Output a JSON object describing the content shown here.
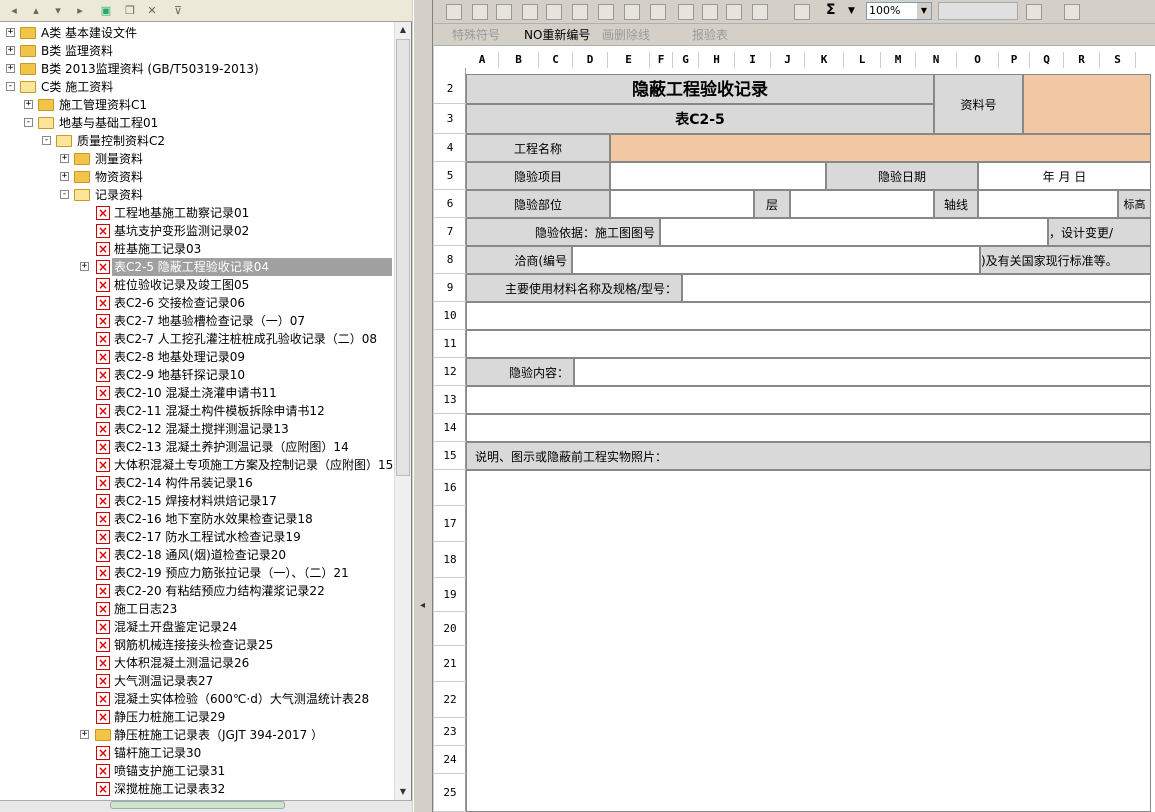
{
  "left_toolbar": {
    "icons": [
      "arrow-left-icon",
      "arrow-up-icon",
      "arrow-down-icon",
      "arrow-right-icon",
      "new-doc-icon",
      "copy-icon",
      "delete-icon",
      "filter-icon"
    ]
  },
  "tree": [
    {
      "label": "A类 基本建设文件",
      "type": "folder",
      "expander": "+"
    },
    {
      "label": "B类 监理资料",
      "type": "folder",
      "expander": "+"
    },
    {
      "label": "B类 2013监理资料 (GB/T50319-2013)",
      "type": "folder",
      "expander": "+"
    },
    {
      "label": "C类 施工资料",
      "type": "folder-open",
      "expander": "-"
    },
    {
      "label": "施工管理资料C1",
      "type": "folder",
      "expander": "+"
    },
    {
      "label": "地基与基础工程01",
      "type": "folder-open",
      "expander": "-"
    },
    {
      "label": "质量控制资料C2",
      "type": "folder-open",
      "expander": "-"
    },
    {
      "label": "测量资料",
      "type": "folder",
      "expander": "+"
    },
    {
      "label": "物资资料",
      "type": "folder",
      "expander": "+"
    },
    {
      "label": "记录资料",
      "type": "folder-open",
      "expander": "-"
    },
    {
      "label": "工程地基施工勘察记录01",
      "type": "doc"
    },
    {
      "label": "基坑支护变形监测记录02",
      "type": "doc"
    },
    {
      "label": "桩基施工记录03",
      "type": "doc"
    },
    {
      "label": "表C2-5 隐蔽工程验收记录04",
      "type": "doc",
      "expander": "+",
      "selected": true
    },
    {
      "label": "桩位验收记录及竣工图05",
      "type": "doc"
    },
    {
      "label": "表C2-6 交接检查记录06",
      "type": "doc"
    },
    {
      "label": "表C2-7 地基验槽检查记录（一）07",
      "type": "doc"
    },
    {
      "label": "表C2-7 人工挖孔灌注桩桩成孔验收记录（二）08",
      "type": "doc"
    },
    {
      "label": "表C2-8 地基处理记录09",
      "type": "doc"
    },
    {
      "label": "表C2-9 地基钎探记录10",
      "type": "doc"
    },
    {
      "label": "表C2-10 混凝土浇灌申请书11",
      "type": "doc"
    },
    {
      "label": "表C2-11 混凝土构件模板拆除申请书12",
      "type": "doc"
    },
    {
      "label": "表C2-12 混凝土搅拌测温记录13",
      "type": "doc"
    },
    {
      "label": "表C2-13 混凝土养护测温记录（应附图）14",
      "type": "doc"
    },
    {
      "label": "大体积混凝土专项施工方案及控制记录（应附图）15",
      "type": "doc"
    },
    {
      "label": "表C2-14 构件吊装记录16",
      "type": "doc"
    },
    {
      "label": "表C2-15 焊接材料烘焙记录17",
      "type": "doc"
    },
    {
      "label": "表C2-16 地下室防水效果检查记录18",
      "type": "doc"
    },
    {
      "label": "表C2-17 防水工程试水检查记录19",
      "type": "doc"
    },
    {
      "label": "表C2-18 通风(烟)道检查记录20",
      "type": "doc"
    },
    {
      "label": "表C2-19 预应力筋张拉记录（一）、（二）21",
      "type": "doc"
    },
    {
      "label": "表C2-20 有粘结预应力结构灌浆记录22",
      "type": "doc"
    },
    {
      "label": "施工日志23",
      "type": "doc"
    },
    {
      "label": "混凝土开盘鉴定记录24",
      "type": "doc"
    },
    {
      "label": "钢筋机械连接接头检查记录25",
      "type": "doc"
    },
    {
      "label": "大体积混凝土测温记录26",
      "type": "doc"
    },
    {
      "label": "大气测温记录表27",
      "type": "doc"
    },
    {
      "label": "混凝土实体检验（600℃·d）大气测温统计表28",
      "type": "doc"
    },
    {
      "label": "静压力桩施工记录29",
      "type": "doc"
    },
    {
      "label": "静压桩施工记录表（JGJT 394-2017 ）",
      "type": "folder",
      "expander": "+"
    },
    {
      "label": "锚杆施工记录30",
      "type": "doc"
    },
    {
      "label": "喷锚支护施工记录31",
      "type": "doc"
    },
    {
      "label": "深搅桩施工记录表32",
      "type": "doc"
    }
  ],
  "right_toolbar": {
    "sigma": "Σ",
    "zoom": "100%",
    "buttons": [
      {
        "label": "特殊符号",
        "enabled": false
      },
      {
        "label": "NO重新编号",
        "enabled": true
      },
      {
        "label": "画删除线",
        "enabled": false
      },
      {
        "label": "报验表",
        "enabled": false
      }
    ]
  },
  "sheet": {
    "columns": [
      "A",
      "B",
      "C",
      "D",
      "E",
      "F",
      "G",
      "H",
      "I",
      "J",
      "K",
      "L",
      "M",
      "N",
      "O",
      "P",
      "Q",
      "R",
      "S"
    ],
    "rows": [
      "2",
      "3",
      "4",
      "5",
      "6",
      "7",
      "8",
      "9",
      "10",
      "11",
      "12",
      "13",
      "14",
      "15",
      "16",
      "17",
      "18",
      "19",
      "20",
      "21",
      "22",
      "23",
      "24",
      "25"
    ],
    "title": "隐蔽工程验收记录",
    "table_no": "表C2-5",
    "doc_no_label": "资料号",
    "project_name_label": "工程名称",
    "item_label": "隐验项目",
    "date_label": "隐验日期",
    "date_placeholder": "年   月   日",
    "location_label": "隐验部位",
    "floor_label": "层",
    "axis_label": "轴线",
    "elevation_label": "标高",
    "basis_label": "隐验依据：施工图图号",
    "design_change_label": "，设计变更/",
    "negotiation_label": "洽商(编号",
    "standard_label": ")及有关国家现行标准等。",
    "materials_label": "主要使用材料名称及规格/型号：",
    "content_label": "隐验内容：",
    "remarks_label": "说明、图示或隐蔽前工程实物照片："
  }
}
